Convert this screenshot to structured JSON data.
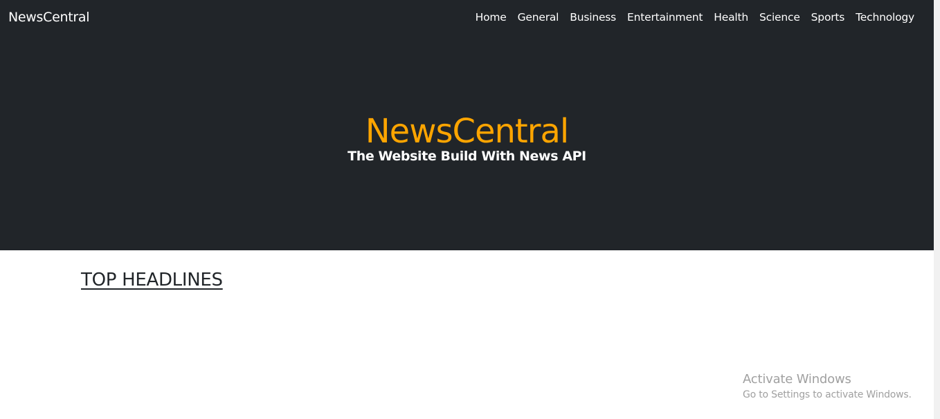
{
  "navbar": {
    "brand": "NewsCentral",
    "links": [
      "Home",
      "General",
      "Business",
      "Entertainment",
      "Health",
      "Science",
      "Sports",
      "Technology"
    ]
  },
  "hero": {
    "title": "NewsCentral",
    "subtitle": "The Website Build With News API"
  },
  "main": {
    "section_title": "TOP HEADLINES"
  },
  "watermark": {
    "title": "Activate Windows",
    "subtitle": "Go to Settings to activate Windows."
  },
  "colors": {
    "dark_bg": "#212529",
    "accent": "#ffa500",
    "text_light": "#ffffff"
  }
}
